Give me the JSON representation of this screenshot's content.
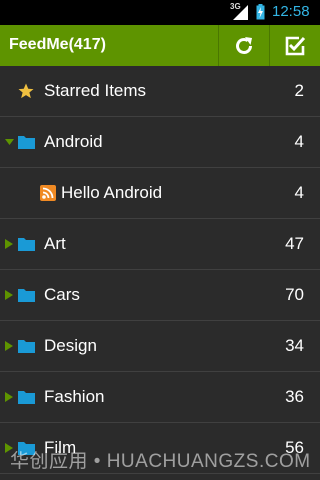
{
  "status_bar": {
    "network": "3G",
    "time": "12:58",
    "time_color": "#33b5e5"
  },
  "action_bar": {
    "title": "FeedMe(417)",
    "bg_color": "#5e9400",
    "refresh_icon": "refresh-icon",
    "mark_read_icon": "checkbox-checked-icon"
  },
  "list": {
    "items": [
      {
        "label": "Starred Items",
        "count": "2",
        "icon": "star-icon"
      },
      {
        "label": "Android",
        "count": "4",
        "icon": "folder-icon",
        "expanded": true
      },
      {
        "label": "Hello Android",
        "count": "4",
        "icon": "rss-icon",
        "child": true
      },
      {
        "label": "Art",
        "count": "47",
        "icon": "folder-icon",
        "expanded": false
      },
      {
        "label": "Cars",
        "count": "70",
        "icon": "folder-icon",
        "expanded": false
      },
      {
        "label": "Design",
        "count": "34",
        "icon": "folder-icon",
        "expanded": false
      },
      {
        "label": "Fashion",
        "count": "36",
        "icon": "folder-icon",
        "expanded": false
      },
      {
        "label": "Film",
        "count": "56",
        "icon": "folder-icon",
        "expanded": false
      }
    ]
  },
  "watermark": "华创应用 • HUACHUANGZS.COM",
  "colors": {
    "folder": "#1a9ad6",
    "arrow": "#5e9400",
    "star": "#f0c040",
    "rss": "#f08a24"
  }
}
